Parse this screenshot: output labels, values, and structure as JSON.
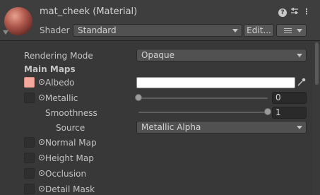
{
  "header": {
    "title": "mat_cheek (Material)",
    "shader_label": "Shader",
    "shader_value": "Standard",
    "edit_label": "Edit...",
    "icons": [
      "help-icon",
      "preset-icon",
      "menu-icon"
    ]
  },
  "properties": {
    "rendering_mode_label": "Rendering Mode",
    "rendering_mode_value": "Opaque",
    "main_maps_label": "Main Maps",
    "albedo_label": "Albedo",
    "albedo_color": "#ffffff",
    "albedo_texture_color": "#f4a79b",
    "metallic_label": "Metallic",
    "metallic_value": "0",
    "metallic_level": 0,
    "smoothness_label": "Smoothness",
    "smoothness_value": "1",
    "smoothness_level": 1,
    "source_label": "Source",
    "source_value": "Metallic Alpha",
    "normal_map_label": "Normal Map",
    "height_map_label": "Height Map",
    "occlusion_label": "Occlusion",
    "detail_mask_label": "Detail Mask"
  }
}
